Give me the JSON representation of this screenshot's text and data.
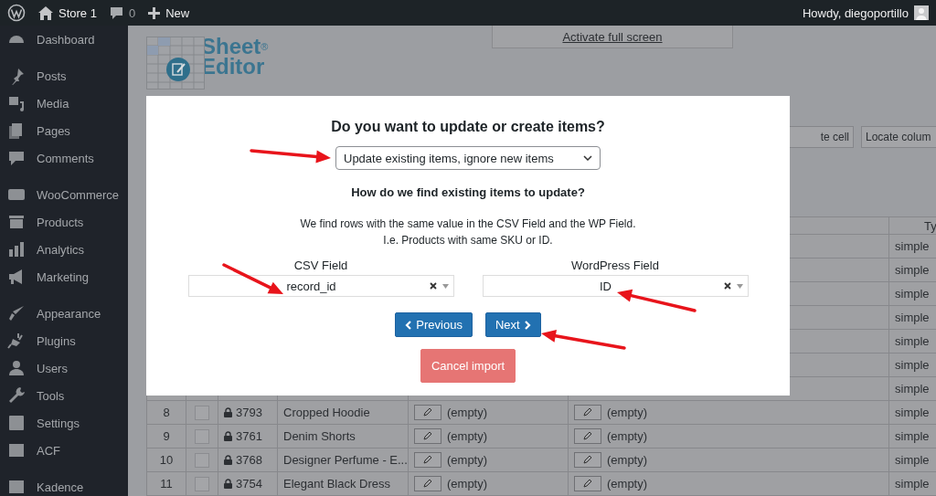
{
  "admin_bar": {
    "site": "Store 1",
    "comments": "0",
    "new": "New",
    "greeting": "Howdy, diegoportillo"
  },
  "sidebar": {
    "groups": [
      [
        "Dashboard"
      ],
      [
        "Posts",
        "Media",
        "Pages",
        "Comments"
      ],
      [
        "WooCommerce",
        "Products",
        "Analytics",
        "Marketing"
      ],
      [
        "Appearance",
        "Plugins",
        "Users",
        "Tools",
        "Settings",
        "ACF"
      ],
      [
        "Kadence"
      ]
    ]
  },
  "logo": {
    "line1": "Sheet",
    "line2": "Editor",
    "mark": "®"
  },
  "fullscreen_link": "Activate full screen",
  "toolbar_fields": [
    {
      "value": "te cell"
    },
    {
      "value": "Locate colum"
    }
  ],
  "table": {
    "type_header": "Ty",
    "rows": [
      {
        "type": "simple"
      },
      {
        "type": "simple"
      },
      {
        "type": "simple"
      },
      {
        "type": "simple"
      },
      {
        "type": "simple"
      },
      {
        "type": "simple"
      },
      {
        "type": "simple"
      },
      {
        "number": "8",
        "checked": false,
        "id": "3793",
        "title": "Cropped Hoodie",
        "column_5": "(empty)",
        "column_6": "(empty)",
        "type": "simple"
      },
      {
        "number": "9",
        "checked": false,
        "id": "3761",
        "title": "Denim Shorts",
        "column_5": "(empty)",
        "column_6": "(empty)",
        "type": "simple"
      },
      {
        "number": "10",
        "checked": false,
        "id": "3768",
        "title": "Designer Perfume - E...",
        "column_5": "(empty)",
        "column_6": "(empty)",
        "type": "simple"
      },
      {
        "number": "11",
        "checked": false,
        "id": "3754",
        "title": "Elegant Black Dress",
        "column_5": "(empty)",
        "column_6": "(empty)",
        "type": "simple"
      }
    ]
  },
  "modal": {
    "title": "Do you want to update or create items?",
    "mode_select": "Update existing items, ignore new items",
    "subtitle": "How do we find existing items to update?",
    "description": [
      "We find rows with the same value in the CSV Field and the WP Field.",
      "I.e. Products with same SKU or ID."
    ],
    "fields": [
      {
        "label": "CSV Field",
        "value": "record_id"
      },
      {
        "label": "WordPress Field",
        "value": "ID"
      }
    ],
    "buttons": [
      {
        "kind": "previous",
        "label": "Previous"
      },
      {
        "kind": "next",
        "label": "Next"
      }
    ],
    "cancel": "Cancel import"
  }
}
